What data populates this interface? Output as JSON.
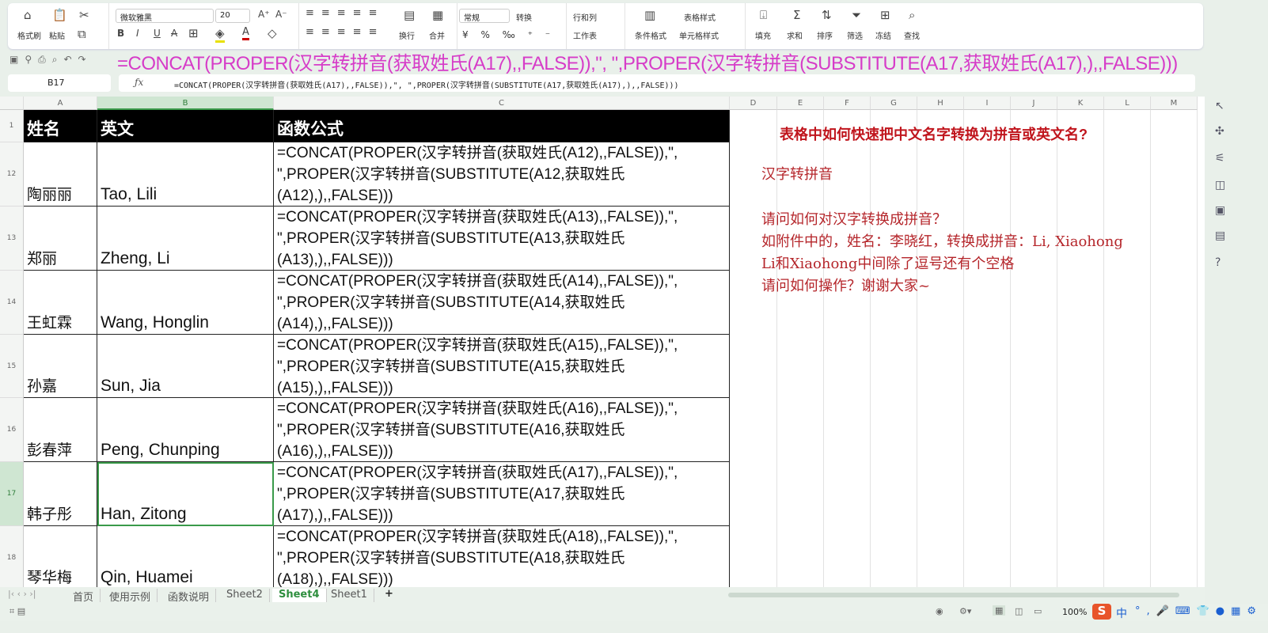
{
  "ribbon": {
    "format_painter": "格式刷",
    "paste": "粘贴",
    "font_name": "微软雅黑",
    "font_size": "20",
    "wrap": "换行",
    "merge": "合并",
    "number_format": "常规",
    "convert": "转换",
    "rows_cols": "行和列",
    "worksheet": "工作表",
    "cond_format": "条件格式",
    "table_style": "表格样式",
    "cell_style": "单元格样式",
    "fill": "填充",
    "sum": "求和",
    "sort": "排序",
    "filter": "筛选",
    "freeze": "冻结",
    "find": "查找"
  },
  "big_formula": "=CONCAT(PROPER(汉字转拼音(获取姓氏(A17),,FALSE)),\", \",PROPER(汉字转拼音(SUBSTITUTE(A17,获取姓氏(A17),),,FALSE)))",
  "name_box": "B17",
  "formula_bar": "=CONCAT(PROPER(汉字转拼音(获取姓氏(A17),,FALSE)),\", \",PROPER(汉字转拼音(SUBSTITUTE(A17,获取姓氏(A17),),,FALSE)))",
  "columns": [
    "A",
    "B",
    "C",
    "D",
    "E",
    "F",
    "G",
    "H",
    "I",
    "J",
    "K",
    "L",
    "M"
  ],
  "header_row": {
    "num": "1",
    "a": "姓名",
    "b": "英文",
    "c": "函数公式"
  },
  "rows": [
    {
      "num": "12",
      "a": "陶丽丽",
      "b": "Tao, Lili",
      "c": [
        "=CONCAT(PROPER(汉字转拼音(获取姓氏(A12),,FALSE)),\",",
        "\",PROPER(汉字转拼音(SUBSTITUTE(A12,获取姓氏",
        "(A12),),,FALSE)))"
      ]
    },
    {
      "num": "13",
      "a": "郑丽",
      "b": "Zheng, Li",
      "c": [
        "=CONCAT(PROPER(汉字转拼音(获取姓氏(A13),,FALSE)),\",",
        "\",PROPER(汉字转拼音(SUBSTITUTE(A13,获取姓氏",
        "(A13),),,FALSE)))"
      ]
    },
    {
      "num": "14",
      "a": "王虹霖",
      "b": "Wang, Honglin",
      "c": [
        "=CONCAT(PROPER(汉字转拼音(获取姓氏(A14),,FALSE)),\",",
        "\",PROPER(汉字转拼音(SUBSTITUTE(A14,获取姓氏",
        "(A14),),,FALSE)))"
      ]
    },
    {
      "num": "15",
      "a": "孙嘉",
      "b": "Sun, Jia",
      "c": [
        "=CONCAT(PROPER(汉字转拼音(获取姓氏(A15),,FALSE)),\",",
        "\",PROPER(汉字转拼音(SUBSTITUTE(A15,获取姓氏",
        "(A15),),,FALSE)))"
      ]
    },
    {
      "num": "16",
      "a": "彭春萍",
      "b": "Peng, Chunping",
      "c": [
        "=CONCAT(PROPER(汉字转拼音(获取姓氏(A16),,FALSE)),\",",
        "\",PROPER(汉字转拼音(SUBSTITUTE(A16,获取姓氏",
        "(A16),),,FALSE)))"
      ]
    },
    {
      "num": "17",
      "a": "韩子彤",
      "b": "Han, Zitong",
      "c": [
        "=CONCAT(PROPER(汉字转拼音(获取姓氏(A17),,FALSE)),\",",
        "\",PROPER(汉字转拼音(SUBSTITUTE(A17,获取姓氏",
        "(A17),),,FALSE)))"
      ]
    },
    {
      "num": "18",
      "a": "琴华梅",
      "b": "Qin, Huamei",
      "c": [
        "=CONCAT(PROPER(汉字转拼音(获取姓氏(A18),,FALSE)),\",",
        "\",PROPER(汉字转拼音(SUBSTITUTE(A18,获取姓氏",
        "(A18),),,FALSE)))"
      ]
    }
  ],
  "note": {
    "title": "表格中如何快速把中文名字转换为拼音或英文名?",
    "lines": [
      "汉字转拼音",
      "请问如何对汉字转换成拼音？",
      "如附件中的，姓名：李晓红，转换成拼音：Li, Xiaohong",
      "Li和Xiaohong中间除了逗号还有个空格",
      "请问如何操作？谢谢大家~"
    ]
  },
  "sheet_tabs": [
    "首页",
    "使用示例",
    "函数说明",
    "Sheet2",
    "Sheet4",
    "Sheet1"
  ],
  "active_tab": "Sheet4",
  "add_tab": "+",
  "zoom": "100%",
  "ime": "中"
}
